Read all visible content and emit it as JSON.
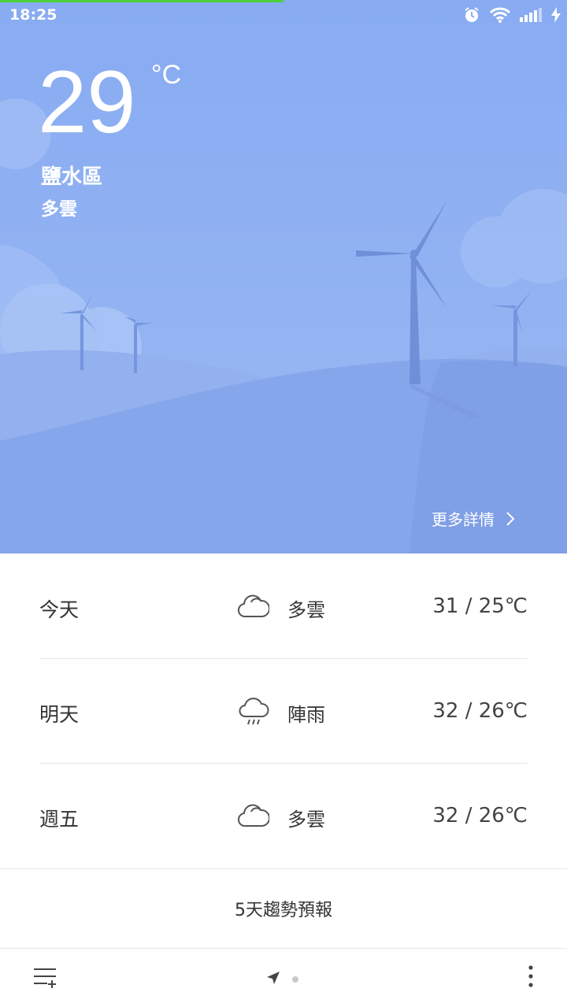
{
  "status_bar": {
    "time": "18:25"
  },
  "current": {
    "temperature": "29",
    "unit": "°C",
    "location": "鹽水區",
    "condition": "多雲"
  },
  "more_details_label": "更多詳情",
  "forecast": [
    {
      "day": "今天",
      "icon": "cloud-icon",
      "condition": "多雲",
      "range": "31 / 25℃"
    },
    {
      "day": "明天",
      "icon": "rain-cloud-icon",
      "condition": "陣雨",
      "range": "32 / 26℃"
    },
    {
      "day": "週五",
      "icon": "cloud-icon",
      "condition": "多雲",
      "range": "32 / 26℃"
    }
  ],
  "trend_label": "5天趨勢預報",
  "colors": {
    "sky": "#8fb1f1",
    "hill_back": "#93b0ef",
    "hill_front": "#7e9fe6",
    "turbine": "#6f8fd8",
    "loading_bar": "#4cd137"
  }
}
